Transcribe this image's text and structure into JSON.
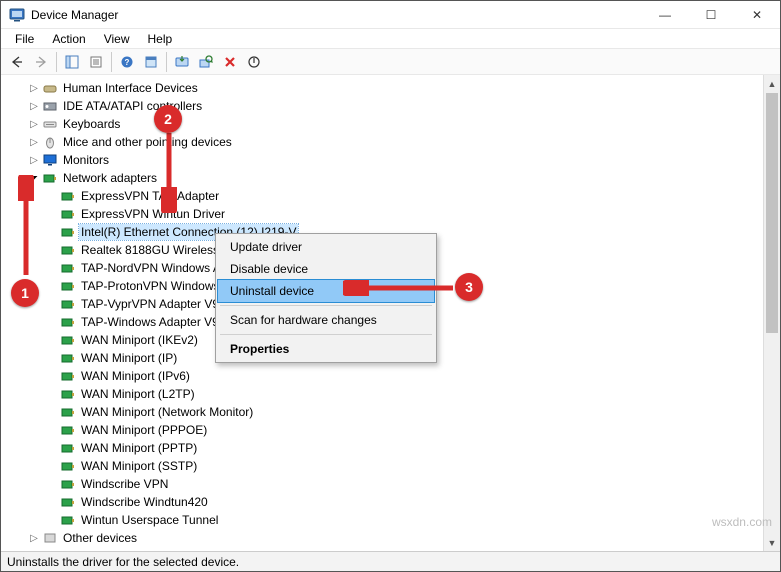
{
  "window": {
    "title": "Device Manager",
    "minimize": "—",
    "maximize": "☐",
    "close": "✕"
  },
  "menu": {
    "file": "File",
    "action": "Action",
    "view": "View",
    "help": "Help"
  },
  "categories": {
    "hid": "Human Interface Devices",
    "ide": "IDE ATA/ATAPI controllers",
    "keyboards": "Keyboards",
    "mice": "Mice and other pointing devices",
    "monitors": "Monitors",
    "network": "Network adapters",
    "other": "Other devices"
  },
  "network_devices": [
    "ExpressVPN TAP Adapter",
    "ExpressVPN Wintun Driver",
    "Intel(R) Ethernet Connection (12) I219-V",
    "Realtek 8188GU Wireless LAN 802.11n USB NIC",
    "TAP-NordVPN Windows Adapter V9",
    "TAP-ProtonVPN Windows Adapter V9",
    "TAP-VyprVPN Adapter V9",
    "TAP-Windows Adapter V9",
    "WAN Miniport (IKEv2)",
    "WAN Miniport (IP)",
    "WAN Miniport (IPv6)",
    "WAN Miniport (L2TP)",
    "WAN Miniport (Network Monitor)",
    "WAN Miniport (PPPOE)",
    "WAN Miniport (PPTP)",
    "WAN Miniport (SSTP)",
    "Windscribe VPN",
    "Windscribe Windtun420",
    "Wintun Userspace Tunnel"
  ],
  "context_menu": {
    "update": "Update driver",
    "disable": "Disable device",
    "uninstall": "Uninstall device",
    "scan": "Scan for hardware changes",
    "properties": "Properties"
  },
  "statusbar": {
    "text": "Uninstalls the driver for the selected device."
  },
  "callouts": {
    "one": "1",
    "two": "2",
    "three": "3"
  },
  "watermark": "wsxdn.com"
}
